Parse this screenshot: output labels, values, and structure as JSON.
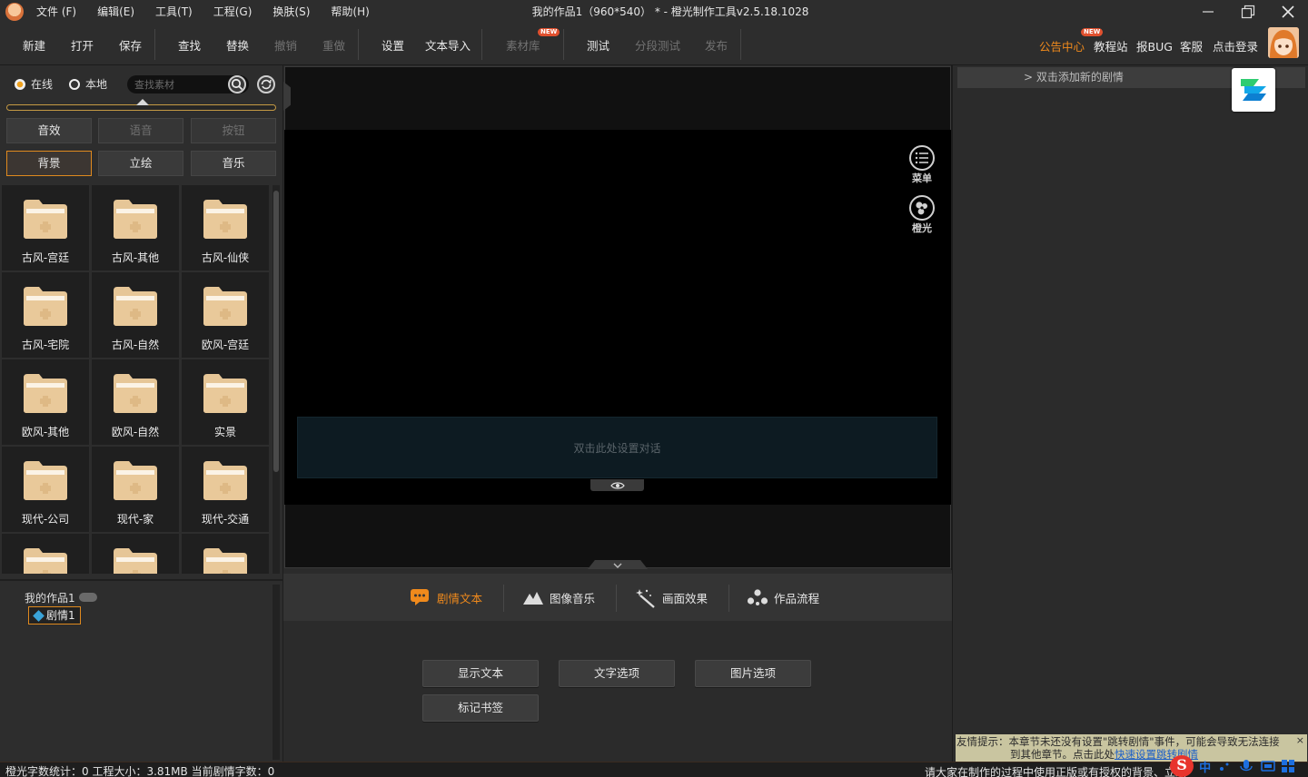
{
  "titlebar": {
    "menus": [
      "文件 (F)",
      "编辑(E)",
      "工具(T)",
      "工程(G)",
      "换肤(S)",
      "帮助(H)"
    ],
    "title": "我的作品1（960*540） * - 橙光制作工具v2.5.18.1028"
  },
  "toolbar": {
    "new": "新建",
    "open": "打开",
    "save": "保存",
    "find": "查找",
    "replace": "替换",
    "undo": "撤销",
    "redo": "重做",
    "settings": "设置",
    "text_import": "文本导入",
    "assets": "素材库",
    "assets_badge": "NEW",
    "test": "测试",
    "segment_test": "分段测试",
    "publish": "发布",
    "announce": "公告中心",
    "tutorial": "教程站",
    "tutorial_badge": "NEW",
    "report_bug": "报BUG",
    "service": "客服",
    "login": "点击登录"
  },
  "left_panel": {
    "online": "在线",
    "local": "本地",
    "search_placeholder": "查找素材",
    "categories": [
      "音效",
      "语音",
      "按钮",
      "背景",
      "立绘",
      "音乐"
    ],
    "folders": [
      "古风-宫廷",
      "古风-其他",
      "古风-仙侠",
      "古风-宅院",
      "古风-自然",
      "欧风-宫廷",
      "欧风-其他",
      "欧风-自然",
      "实景",
      "现代-公司",
      "现代-家",
      "现代-交通",
      "",
      "",
      ""
    ],
    "tree_root": "我的作品1",
    "tree_item": "剧情1"
  },
  "stage": {
    "dialog_placeholder": "双击此处设置对话",
    "menu_label": "菜单",
    "brand_label": "橙光"
  },
  "tabs": [
    "剧情文本",
    "图像音乐",
    "画面效果",
    "作品流程"
  ],
  "options": [
    "显示文本",
    "文字选项",
    "图片选项",
    "标记书签"
  ],
  "right_panel": {
    "add_plot": "> 双击添加新的剧情",
    "hint_line1": "友情提示：本章节未还没有设置\"跳转剧情\"事件，可能会导致无法连接",
    "hint_line2_pre": "到其他章节。点击此处",
    "hint_link": "快速设置跳转剧情",
    "hint_close": "×"
  },
  "statusbar": {
    "left": "橙光字数统计：0 工程大小：3.81MB 当前剧情字数：0",
    "right": "请大家在制作的过程中使用正版或有授权的背景、立绘"
  },
  "ime": {
    "logo": "S",
    "lang": "中"
  },
  "colors": {
    "accent": "#f08a1c",
    "badge": "#e0502e",
    "folder": "#e9c99a"
  }
}
